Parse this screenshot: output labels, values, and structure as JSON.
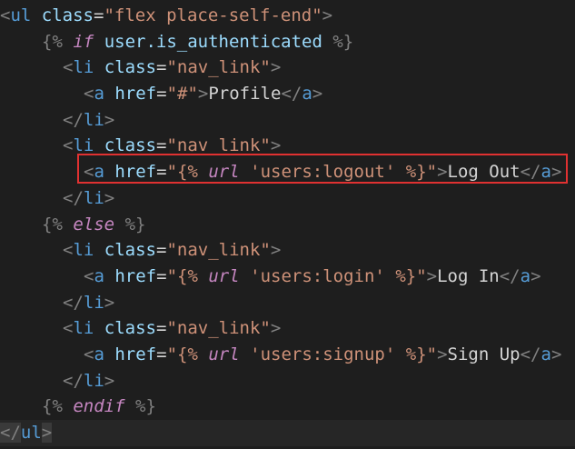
{
  "editor": {
    "lines": [
      {
        "id": "ul-open",
        "tokens": [
          "<",
          "ul",
          " ",
          "class",
          "=",
          "\"flex place-self-end\"",
          ">"
        ]
      },
      {
        "id": "if-auth",
        "tokens": [
          "{%",
          " ",
          "if",
          " ",
          "user.is_authenticated",
          " ",
          "%}"
        ]
      },
      {
        "id": "li-profile-open",
        "tokens": [
          "<",
          "li",
          " ",
          "class",
          "=",
          "\"nav_link\"",
          ">"
        ]
      },
      {
        "id": "a-profile",
        "tokens": [
          "<",
          "a",
          " ",
          "href",
          "=",
          "\"#\"",
          ">",
          "Profile",
          "</",
          "a",
          ">"
        ]
      },
      {
        "id": "li-profile-close",
        "tokens": [
          "</",
          "li",
          ">"
        ]
      },
      {
        "id": "li-logout-open",
        "tokens": [
          "<",
          "li",
          " ",
          "class",
          "=",
          "\"nav_link\"",
          ">"
        ]
      },
      {
        "id": "a-logout",
        "tokens": [
          "<",
          "a",
          " ",
          "href",
          "=",
          "\"{%",
          " ",
          "url",
          " ",
          "'users:logout'",
          " ",
          "%}\"",
          ">",
          "Log Out",
          "</",
          "a",
          ">"
        ]
      },
      {
        "id": "li-logout-close",
        "tokens": [
          "</",
          "li",
          ">"
        ]
      },
      {
        "id": "else",
        "tokens": [
          "{%",
          " ",
          "else",
          " ",
          "%}"
        ]
      },
      {
        "id": "li-login-open",
        "tokens": [
          "<",
          "li",
          " ",
          "class",
          "=",
          "\"nav_link\"",
          ">"
        ]
      },
      {
        "id": "a-login",
        "tokens": [
          "<",
          "a",
          " ",
          "href",
          "=",
          "\"{%",
          " ",
          "url",
          " ",
          "'users:login'",
          " ",
          "%}\"",
          ">",
          "Log In",
          "</",
          "a",
          ">"
        ]
      },
      {
        "id": "li-login-close",
        "tokens": [
          "</",
          "li",
          ">"
        ]
      },
      {
        "id": "li-signup-open",
        "tokens": [
          "<",
          "li",
          " ",
          "class",
          "=",
          "\"nav_link\"",
          ">"
        ]
      },
      {
        "id": "a-signup",
        "tokens": [
          "<",
          "a",
          " ",
          "href",
          "=",
          "\"{%",
          " ",
          "url",
          " ",
          "'users:signup'",
          " ",
          "%}\"",
          ">",
          "Sign Up",
          "</",
          "a",
          ">"
        ]
      },
      {
        "id": "li-signup-close",
        "tokens": [
          "</",
          "li",
          ">"
        ]
      },
      {
        "id": "endif",
        "tokens": [
          "{%",
          " ",
          "endif",
          " ",
          "%}"
        ]
      },
      {
        "id": "ul-close",
        "tokens": [
          "</",
          "ul",
          ">"
        ]
      }
    ]
  },
  "colors": {
    "background": "#1e1e1e",
    "tag": "#569cd6",
    "bracket": "#808080",
    "attribute": "#9cdcfe",
    "string": "#ce9178",
    "keyword": "#c586c0",
    "text": "#d4d4d4",
    "highlight_border": "#e03131"
  }
}
